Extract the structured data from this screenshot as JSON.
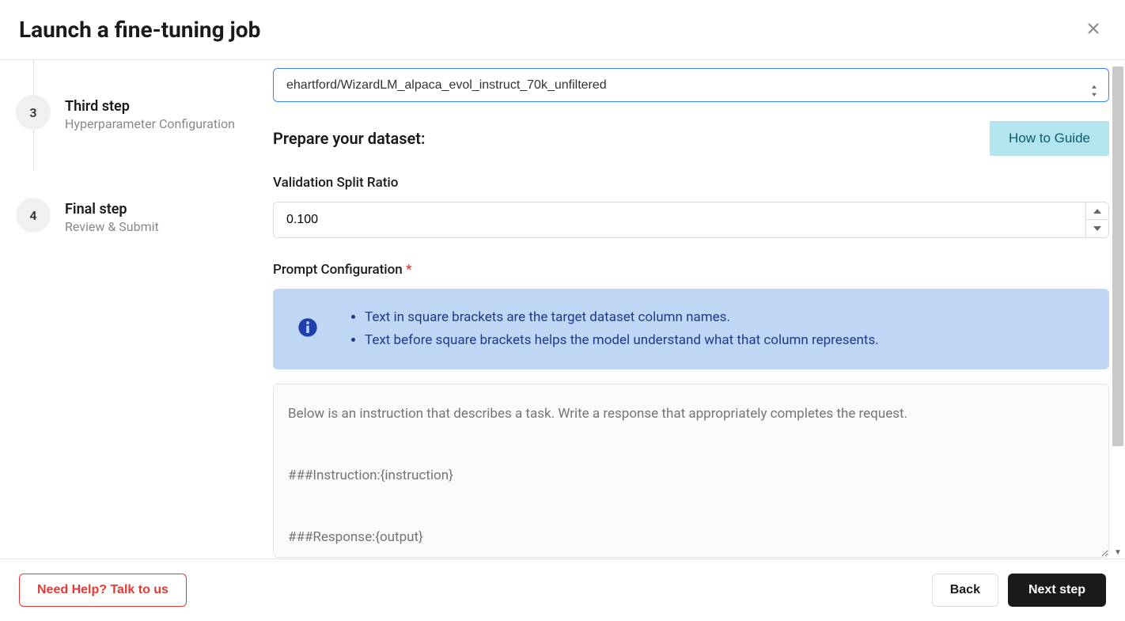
{
  "header": {
    "title": "Launch a fine-tuning job"
  },
  "sidebar": {
    "steps": [
      {
        "number": "3",
        "title": "Third step",
        "subtitle": "Hyperparameter Configuration"
      },
      {
        "number": "4",
        "title": "Final step",
        "subtitle": "Review & Submit"
      }
    ]
  },
  "main": {
    "dataset_select_value": "ehartford/WizardLM_alpaca_evol_instruct_70k_unfiltered",
    "prepare_title": "Prepare your dataset:",
    "guide_button": "How to Guide",
    "validation_label": "Validation Split Ratio",
    "validation_value": "0.100",
    "prompt_config_label": "Prompt Configuration",
    "required_asterisk": " *",
    "info_items": [
      "Text in square brackets are the target dataset column names.",
      "Text before square brackets helps the model understand what that column represents."
    ],
    "prompt_placeholder": "Below is an instruction that describes a task. Write a response that appropriately completes the request.\n\n###Instruction:{instruction}\n\n###Response:{output}"
  },
  "footer": {
    "help_button": "Need Help? Talk to us",
    "back_button": "Back",
    "next_button": "Next step"
  }
}
